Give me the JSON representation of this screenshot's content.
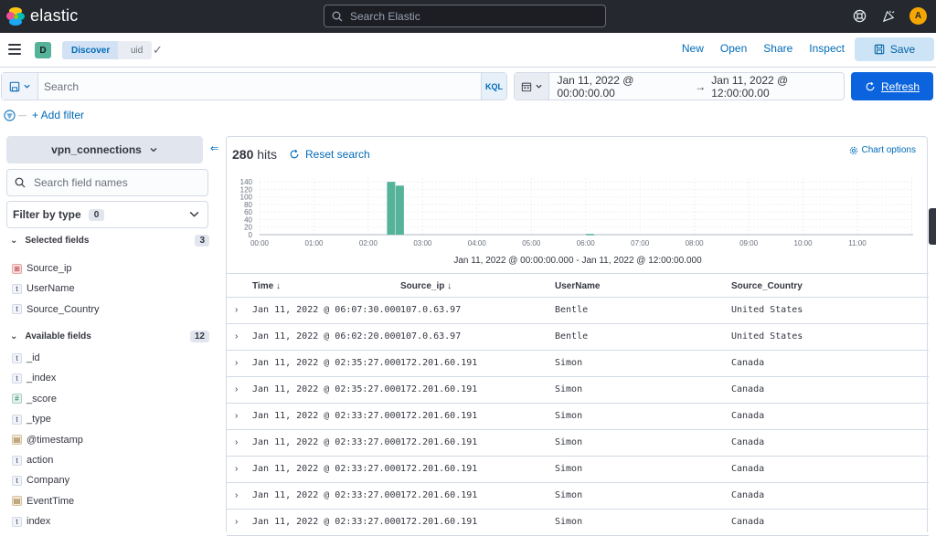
{
  "header": {
    "brand": "elastic",
    "search_placeholder": "Search Elastic",
    "avatar_letter": "A"
  },
  "nav": {
    "space_letter": "D",
    "breadcrumb_app": "Discover",
    "breadcrumb_page": "uid",
    "links": [
      "New",
      "Open",
      "Share",
      "Inspect"
    ],
    "save_label": "Save"
  },
  "query": {
    "placeholder": "Search",
    "language": "KQL",
    "date_start": "Jan 11, 2022 @ 00:00:00.00",
    "date_arrow": "→",
    "date_end": "Jan 11, 2022 @ 12:00:00.00",
    "refresh_label": "Refresh",
    "add_filter_label": "+ Add filter"
  },
  "sidebar": {
    "index_pattern": "vpn_connections",
    "field_search_placeholder": "Search field names",
    "filter_by_type_label": "Filter by type",
    "filter_by_type_count": "0",
    "selected_label": "Selected fields",
    "selected_count": "3",
    "selected_fields": [
      {
        "name": "Source_ip",
        "type": "ip"
      },
      {
        "name": "UserName",
        "type": "t"
      },
      {
        "name": "Source_Country",
        "type": "t"
      }
    ],
    "available_label": "Available fields",
    "available_count": "12",
    "available_fields": [
      {
        "name": "_id",
        "type": "t"
      },
      {
        "name": "_index",
        "type": "t"
      },
      {
        "name": "_score",
        "type": "#"
      },
      {
        "name": "_type",
        "type": "t"
      },
      {
        "name": "@timestamp",
        "type": "date"
      },
      {
        "name": "action",
        "type": "t"
      },
      {
        "name": "Company",
        "type": "t"
      },
      {
        "name": "EventTime",
        "type": "date"
      },
      {
        "name": "index",
        "type": "t"
      }
    ]
  },
  "main": {
    "hits_count": "280",
    "hits_label": "hits",
    "reset_label": "Reset search",
    "chart_options_label": "Chart options",
    "time_range_label": "Jan 11, 2022 @ 00:00:00.000 - Jan 11, 2022 @ 12:00:00.000"
  },
  "chart_data": {
    "type": "bar",
    "x_ticks": [
      "00:00",
      "01:00",
      "02:00",
      "03:00",
      "04:00",
      "05:00",
      "06:00",
      "07:00",
      "08:00",
      "09:00",
      "10:00",
      "11:00"
    ],
    "y_ticks": [
      "0",
      "20",
      "40",
      "60",
      "80",
      "100",
      "120",
      "140"
    ],
    "ylim": [
      0,
      150
    ],
    "bars": [
      {
        "hour": 2.42,
        "count": 140
      },
      {
        "hour": 2.58,
        "count": 130
      },
      {
        "hour": 6.08,
        "count": 2
      }
    ],
    "color": "#54b399"
  },
  "table": {
    "columns": [
      "Time ↓",
      "Source_ip ↓",
      "UserName",
      "Source_Country"
    ],
    "rows": [
      [
        "Jan 11, 2022 @ 06:07:30.000",
        "107.0.63.97",
        "Bentle",
        "United States"
      ],
      [
        "Jan 11, 2022 @ 06:02:20.000",
        "107.0.63.97",
        "Bentle",
        "United States"
      ],
      [
        "Jan 11, 2022 @ 02:35:27.000",
        "172.201.60.191",
        "Simon",
        "Canada"
      ],
      [
        "Jan 11, 2022 @ 02:35:27.000",
        "172.201.60.191",
        "Simon",
        "Canada"
      ],
      [
        "Jan 11, 2022 @ 02:33:27.000",
        "172.201.60.191",
        "Simon",
        "Canada"
      ],
      [
        "Jan 11, 2022 @ 02:33:27.000",
        "172.201.60.191",
        "Simon",
        "Canada"
      ],
      [
        "Jan 11, 2022 @ 02:33:27.000",
        "172.201.60.191",
        "Simon",
        "Canada"
      ],
      [
        "Jan 11, 2022 @ 02:33:27.000",
        "172.201.60.191",
        "Simon",
        "Canada"
      ],
      [
        "Jan 11, 2022 @ 02:33:27.000",
        "172.201.60.191",
        "Simon",
        "Canada"
      ]
    ]
  }
}
